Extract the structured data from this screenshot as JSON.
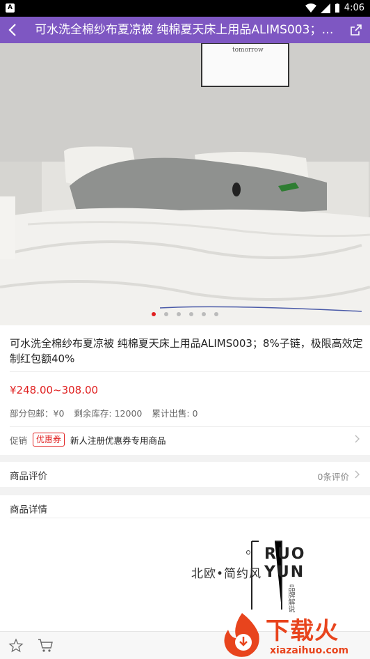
{
  "status_bar": {
    "time": "4:06",
    "app_badge": "A"
  },
  "app_bar": {
    "title": "可水洗全棉纱布夏凉被 纯棉夏天床上用品ALIMS003；8%子链，极限高效定制红包额40%"
  },
  "hero": {
    "picture_caption": "tomorrow",
    "slide_count": 6,
    "active_slide": 0
  },
  "product": {
    "title": "可水洗全棉纱布夏凉被 纯棉夏天床上用品ALIMS003；8%子链，极限高效定制红包额40%",
    "price": "¥248.00~308.00",
    "shipping": "部分包邮：¥0",
    "stock": "剩余库存: 12000",
    "sold": "累计出售: 0"
  },
  "promo": {
    "label": "促销",
    "badge": "优惠券",
    "text": "新人注册优惠券专用商品"
  },
  "reviews": {
    "label": "商品评价",
    "count": "0条评价"
  },
  "details": {
    "label": "商品详情",
    "brand_slogan": "北欧•简约风",
    "brand_ruo": "RUO",
    "brand_yun": "YUN",
    "brand_vertical": "品牌解说"
  },
  "watermark": {
    "cn": "下载火",
    "url": "xiazaihuo.com"
  },
  "colors": {
    "accent": "#7e57c2",
    "price": "#e02020",
    "watermark": "#e8441d"
  }
}
